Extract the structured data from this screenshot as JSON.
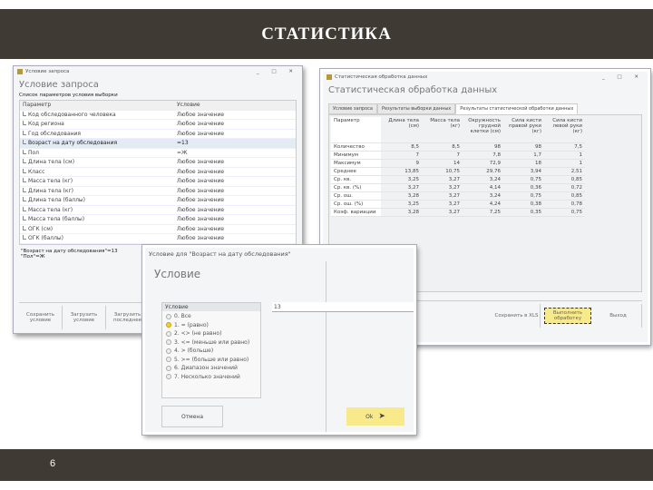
{
  "slide": {
    "title": "СТАТИСТИКА",
    "page_number": "6"
  },
  "query_window": {
    "title": "Условие запроса",
    "heading": "Условие запроса",
    "list_label": "Список параметров условия выборки",
    "col_param": "Параметр",
    "col_value": "Условие",
    "rows": [
      {
        "param": "Код обследованного человека",
        "value": "Любое значение"
      },
      {
        "param": "Код региона",
        "value": "Любое значение"
      },
      {
        "param": "Год обследования",
        "value": "Любое значение"
      },
      {
        "param": "Возраст на дату обследования",
        "value": "=13",
        "selected": true
      },
      {
        "param": "Пол",
        "value": "=Ж"
      },
      {
        "param": "Длина тела (см)",
        "value": "Любое значение"
      },
      {
        "param": "Класс",
        "value": "Любое значение"
      },
      {
        "param": "Масса тела (кг)",
        "value": "Любое значение"
      },
      {
        "param": "Длина тела (кг)",
        "value": "Любое значение"
      },
      {
        "param": "Длина тела (баллы)",
        "value": "Любое значение"
      },
      {
        "param": "Масса тела (кг)",
        "value": "Любое значение"
      },
      {
        "param": "Масса тела (баллы)",
        "value": "Любое значение"
      },
      {
        "param": "ОГК (см)",
        "value": "Любое значение"
      },
      {
        "param": "ОГК (баллы)",
        "value": "Любое значение"
      }
    ],
    "summary": [
      "\"Возраст на дату обследования\"=13",
      "\"Пол\"=Ж"
    ],
    "buttons": [
      "Сохранить условие",
      "Загрузить условие",
      "Загрузить последнее"
    ]
  },
  "stats_window": {
    "title": "Статистическая обработка данных",
    "heading": "Статистическая обработка данных",
    "tabs": [
      "Условие запроса",
      "Результаты выборки данных",
      "Результаты статистической обработки данных"
    ],
    "columns": [
      "Параметр",
      "Длина тела (см)",
      "Масса тела (кг)",
      "Окружность грудной клетки (см)",
      "Сила кисти правой руки (кг)",
      "Сила кисти левой руки (кг)"
    ],
    "rows": [
      [
        "Количество",
        "8,5",
        "8,5",
        "98",
        "98",
        "7,5"
      ],
      [
        "Минимум",
        "7",
        "7",
        "7,8",
        "1,7",
        "1"
      ],
      [
        "Максимум",
        "9",
        "14",
        "72,9",
        "18",
        "1"
      ],
      [
        "Среднее",
        "13,85",
        "10,75",
        "29,76",
        "3,94",
        "2,51"
      ],
      [
        "Ср. кв.",
        "3,25",
        "3,27",
        "3,24",
        "0,75",
        "0,85"
      ],
      [
        "Ср. кв. (%)",
        "3,27",
        "3,27",
        "4,14",
        "0,36",
        "0,72"
      ],
      [
        "Ср. ош.",
        "3,28",
        "3,27",
        "3,24",
        "0,75",
        "0,85"
      ],
      [
        "Ср. ош. (%)",
        "3,25",
        "3,27",
        "4,24",
        "0,38",
        "0,78"
      ],
      [
        "Коэф. вариации",
        "3,28",
        "3,27",
        "7,25",
        "0,35",
        "0,75"
      ]
    ],
    "buttons": [
      "Сохранить в XLS",
      "Выполнить обработку",
      "Выход"
    ]
  },
  "condition_dialog": {
    "title": "Условие для \"Возраст на дату обследования\"",
    "heading": "Условие",
    "group_label": "Условие",
    "value": "13",
    "options": [
      "0. Все",
      "1. = (равно)",
      "2. <> (не равно)",
      "3. <= (меньше или равно)",
      "4. > (больше)",
      "5. >= (больше или равно)",
      "6. Диапазон значений",
      "7. Несколько значений"
    ],
    "selected_index": 1,
    "cancel": "Отмена",
    "ok": "Ok"
  }
}
